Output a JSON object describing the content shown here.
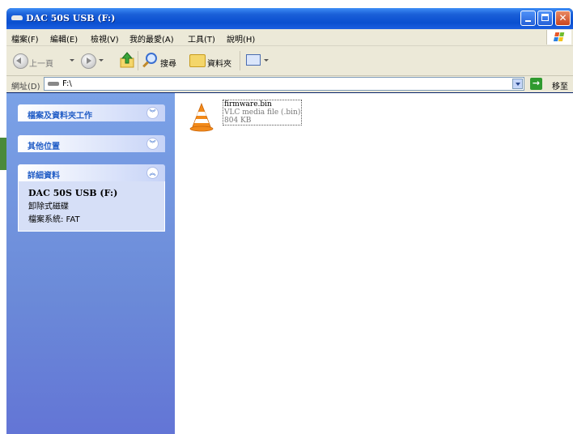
{
  "window": {
    "title": "DAC 50S USB (F:)"
  },
  "menu": {
    "items": [
      "檔案(F)",
      "編輯(E)",
      "檢視(V)",
      "我的最愛(A)",
      "工具(T)",
      "說明(H)"
    ]
  },
  "toolbar": {
    "back_label": "上一頁",
    "search_label": "搜尋",
    "folders_label": "資料夾"
  },
  "address": {
    "label": "網址(D)",
    "value": "F:\\",
    "go_label": "移至"
  },
  "sidebar": {
    "tasks_header": "檔案及資料夾工作",
    "places_header": "其他位置",
    "details_header": "詳細資料",
    "details": {
      "name": "DAC 50S USB (F:)",
      "type": "卸除式磁碟",
      "fs": "檔案系統: FAT"
    }
  },
  "files": [
    {
      "name": "firmware.bin",
      "type": "VLC media file (.bin)",
      "size": "804 KB",
      "icon": "vlc-cone-icon"
    }
  ],
  "colors": {
    "title_blue": "#0a4fd0",
    "panel_blue": "#6b8ad8",
    "link_blue": "#215dc6",
    "close_red": "#c9451f"
  }
}
